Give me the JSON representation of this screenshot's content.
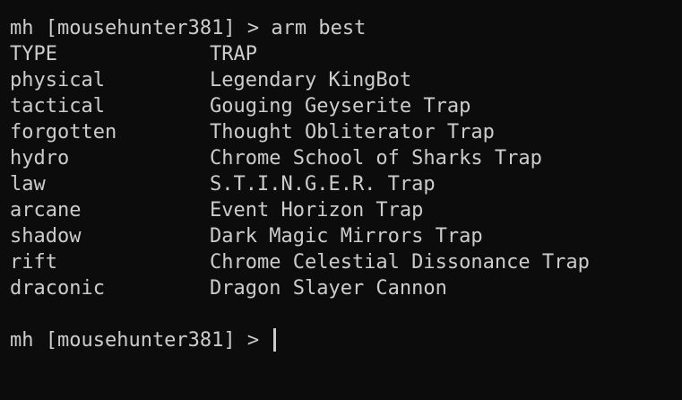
{
  "terminal": {
    "command_line": "mh [mousehunter381] > arm best",
    "header": {
      "type": "TYPE",
      "trap": "TRAP"
    },
    "rows": [
      {
        "type": "physical",
        "trap": "Legendary KingBot"
      },
      {
        "type": "tactical",
        "trap": "Gouging Geyserite Trap"
      },
      {
        "type": "forgotten",
        "trap": "Thought Obliterator Trap"
      },
      {
        "type": "hydro",
        "trap": "Chrome School of Sharks Trap"
      },
      {
        "type": "law",
        "trap": "S.T.I.N.G.E.R. Trap"
      },
      {
        "type": "arcane",
        "trap": "Event Horizon Trap"
      },
      {
        "type": "shadow",
        "trap": "Dark Magic Mirrors Trap"
      },
      {
        "type": "rift",
        "trap": "Chrome Celestial Dissonance Trap"
      },
      {
        "type": "draconic",
        "trap": "Dragon Slayer Cannon"
      }
    ],
    "prompt": "mh [mousehunter381] > ",
    "colors": {
      "background": "#0c0c0c",
      "text": "#cccccc"
    }
  }
}
